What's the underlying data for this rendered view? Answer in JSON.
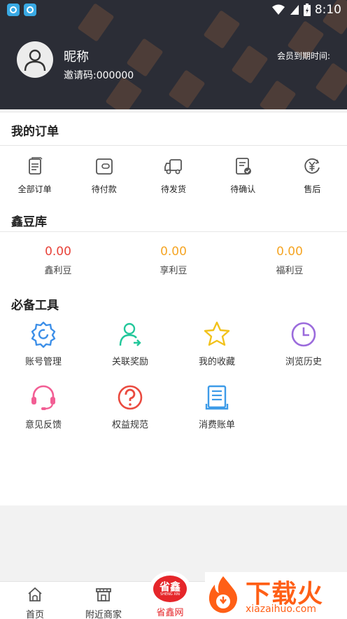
{
  "status_bar": {
    "time": "8:10",
    "icons": [
      "wifi-icon",
      "signal-icon",
      "battery-icon"
    ]
  },
  "profile": {
    "nickname": "昵称",
    "invite_code": "邀请码:000000",
    "member_expiry_label": "会员到期时间:"
  },
  "orders": {
    "title": "我的订单",
    "items": [
      {
        "label": "全部订单",
        "icon": "document-icon"
      },
      {
        "label": "待付款",
        "icon": "wallet-icon"
      },
      {
        "label": "待发货",
        "icon": "truck-icon"
      },
      {
        "label": "待确认",
        "icon": "receipt-check-icon"
      },
      {
        "label": "售后",
        "icon": "yen-refund-icon"
      }
    ]
  },
  "beans": {
    "title": "鑫豆库",
    "items": [
      {
        "value": "0.00",
        "label": "鑫利豆",
        "color": "#e8433a"
      },
      {
        "value": "0.00",
        "label": "享利豆",
        "color": "#f5a524"
      },
      {
        "value": "0.00",
        "label": "福利豆",
        "color": "#f5a524"
      }
    ]
  },
  "tools": {
    "title": "必备工具",
    "items": [
      {
        "label": "账号管理",
        "icon": "gear-icon",
        "color": "#3d8fe8"
      },
      {
        "label": "关联奖励",
        "icon": "user-link-icon",
        "color": "#21c79a"
      },
      {
        "label": "我的收藏",
        "icon": "star-icon",
        "color": "#f2c21b"
      },
      {
        "label": "浏览历史",
        "icon": "clock-icon",
        "color": "#9b6bdc"
      },
      {
        "label": "意见反馈",
        "icon": "headset-icon",
        "color": "#f25e94"
      },
      {
        "label": "权益规范",
        "icon": "question-icon",
        "color": "#ea4a3f"
      },
      {
        "label": "消费账单",
        "icon": "bill-icon",
        "color": "#3d9be8"
      }
    ]
  },
  "bottom_nav": {
    "items": [
      {
        "label": "首页",
        "icon": "home-icon"
      },
      {
        "label": "附近商家",
        "icon": "shop-icon"
      },
      {
        "label": "省鑫网",
        "icon": "brand-logo",
        "active": true
      }
    ],
    "center_logo_text": "省鑫",
    "center_logo_sub": "SHENG XIN",
    "active_color": "#e5262a"
  },
  "watermark_badge": {
    "title": "下载火",
    "subtitle": "xiazaihuo.com",
    "color": "#ff5f16"
  }
}
